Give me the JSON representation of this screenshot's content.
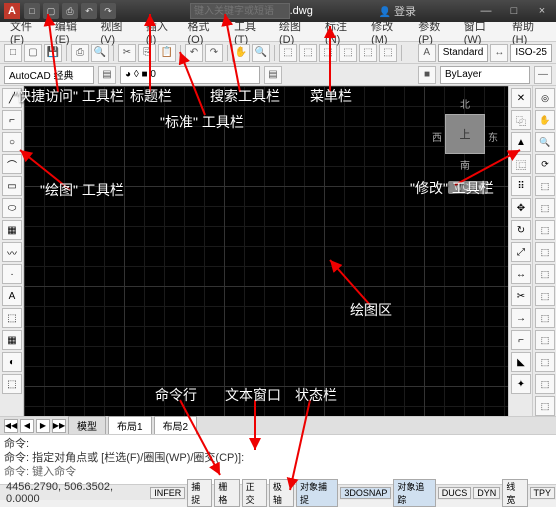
{
  "titlebar": {
    "logo": "A",
    "title": "Drawing1.dwg",
    "search_placeholder": "键入关键字或短语",
    "login": "登录",
    "min": "—",
    "max": "□",
    "close": "×"
  },
  "qat": [
    "□",
    "▢",
    "⎙",
    "↶",
    "↷"
  ],
  "menu": [
    "文件(F)",
    "编辑(E)",
    "视图(V)",
    "插入(I)",
    "格式(O)",
    "工具(T)",
    "绘图(D)",
    "标注(N)",
    "修改(M)",
    "参数(P)",
    "窗口(W)",
    "帮助(H)"
  ],
  "toolbar_std": {
    "dd": "Standard",
    "dd2": "ISO-25"
  },
  "toolbar_layer": {
    "workspace": "AutoCAD 经典",
    "bylayer": "ByLayer"
  },
  "viewcube": {
    "top": "上",
    "n": "北",
    "s": "南",
    "e": "东",
    "w": "西",
    "wcs": "WCS ▾"
  },
  "tabs": {
    "model": "模型",
    "layout1": "布局1",
    "layout2": "布局2"
  },
  "cmd": {
    "l1": "命令:",
    "l2": "命令: 指定对角点或 [栏选(F)/圈围(WP)/圈交(CP)]:",
    "prompt": "命令: 键入命令"
  },
  "status": {
    "coords": "4456.2790, 506.3502, 0.0000",
    "items": [
      "INFER",
      "捕捉",
      "栅格",
      "正交",
      "极轴",
      "对象捕捉",
      "3DOSNAP",
      "对象追踪",
      "DUCS",
      "DYN",
      "线宽",
      "TPY"
    ]
  },
  "ann": {
    "qat": "\"快捷访问\" 工具栏",
    "title": "标题栏",
    "search": "搜索工具栏",
    "menu": "菜单栏",
    "std": "\"标准\" 工具栏",
    "draw": "\"绘图\" 工具栏",
    "modify": "\"修改\" 工具栏",
    "canvas": "绘图区",
    "textwin": "文本窗口",
    "cmdline": "命令行",
    "statusbar": "状态栏"
  }
}
